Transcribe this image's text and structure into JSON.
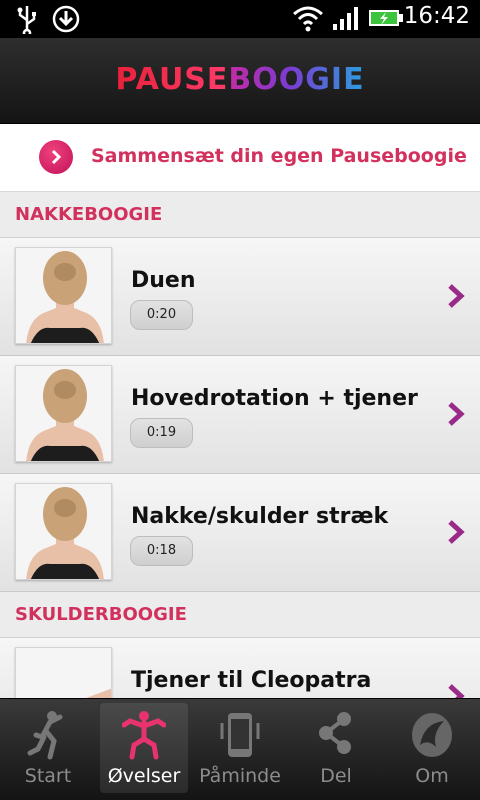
{
  "status_bar": {
    "time": "16:42",
    "icons": [
      "usb-icon",
      "download-icon",
      "wifi-icon",
      "signal-icon",
      "battery-charging-icon"
    ]
  },
  "header": {
    "logo_part1": "PAUSE",
    "logo_part2": "BOOGIE"
  },
  "compose": {
    "label": "Sammensæt din egen Pauseboogie",
    "icon": "chevron-right-circle-icon"
  },
  "sections": [
    {
      "title": "NAKKEBOOGIE",
      "items": [
        {
          "title": "Duen",
          "duration": "0:20"
        },
        {
          "title": "Hovedrotation + tjener",
          "duration": "0:19"
        },
        {
          "title": "Nakke/skulder stræk",
          "duration": "0:18"
        }
      ]
    },
    {
      "title": "SKULDERBOOGIE",
      "items": [
        {
          "title": "Tjener til Cleopatra"
        }
      ]
    }
  ],
  "bottom_nav": {
    "tabs": [
      {
        "label": "Start",
        "icon": "person-stretch-icon",
        "active": false
      },
      {
        "label": "Øvelser",
        "icon": "person-dance-icon",
        "active": true
      },
      {
        "label": "Påminde",
        "icon": "phone-vibrate-icon",
        "active": false
      },
      {
        "label": "Del",
        "icon": "share-icon",
        "active": false
      },
      {
        "label": "Om",
        "icon": "app-logo-icon",
        "active": false
      }
    ]
  },
  "colors": {
    "accent": "#d3315d",
    "chevron": "#9a2a8a",
    "active_tab_icon": "#e8336f"
  }
}
